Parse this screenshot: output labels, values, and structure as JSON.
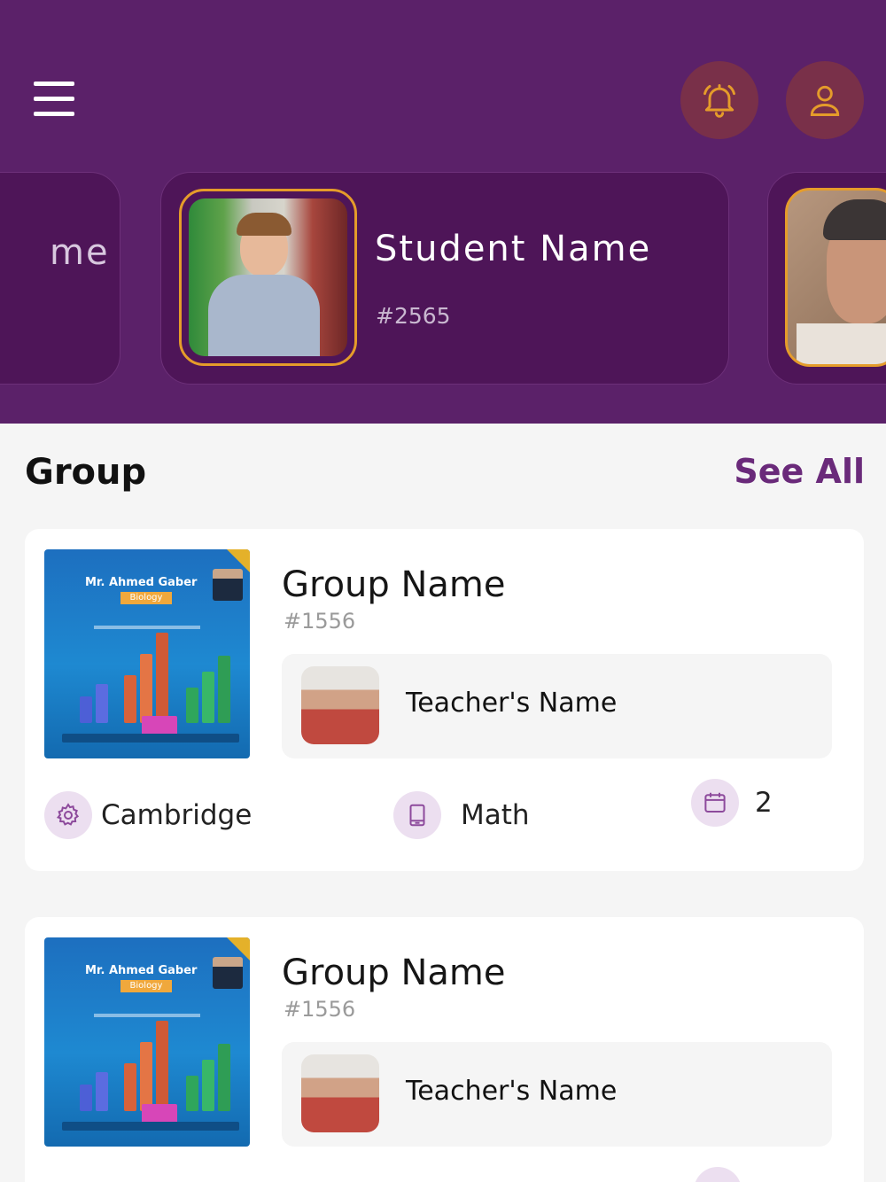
{
  "header": {
    "colors": {
      "background": "#5b2169",
      "card": "#4e1558",
      "accent": "#e59c2a"
    },
    "icons": {
      "menu": "menu-icon",
      "notification": "bell-icon",
      "profile": "user-icon"
    }
  },
  "students": {
    "previous_label_fragment": "me",
    "current": {
      "name": "Student Name",
      "id": "#2565"
    }
  },
  "groups_section": {
    "title": "Group",
    "see_all_label": "See All",
    "items": [
      {
        "poster": {
          "title": "Mr. Ahmed Gaber",
          "badge": "Biology"
        },
        "name": "Group Name",
        "id": "#1556",
        "teacher_name": "Teacher's Name",
        "curriculum": "Cambridge",
        "subject": "Math",
        "count": "2"
      },
      {
        "poster": {
          "title": "Mr. Ahmed Gaber",
          "badge": "Biology"
        },
        "name": "Group Name",
        "id": "#1556",
        "teacher_name": "Teacher's Name"
      }
    ]
  }
}
